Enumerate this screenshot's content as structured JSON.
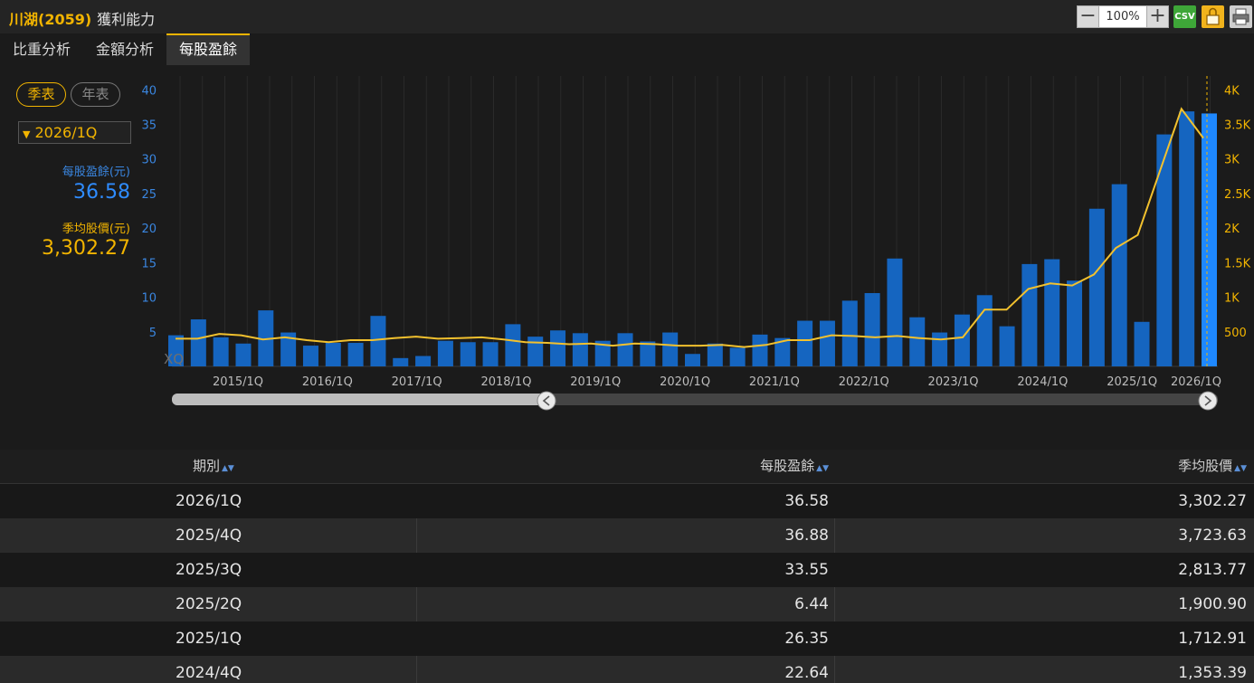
{
  "header": {
    "title": "川湖(2059)",
    "subtitle": "獲利能力",
    "zoom": "100%",
    "csv_label": "CSV",
    "icons": [
      "minus-icon",
      "plus-icon",
      "csv-icon",
      "lock-icon",
      "print-icon"
    ]
  },
  "tabs": [
    {
      "label": "比重分析"
    },
    {
      "label": "金額分析"
    },
    {
      "label": "每股盈餘",
      "active": true
    }
  ],
  "controls": {
    "quarterly": "季表",
    "annual": "年表",
    "period": "2026/1Q"
  },
  "summary": {
    "eps_label": "每股盈餘(元)",
    "eps_value": "36.58",
    "price_label": "季均股價(元)",
    "price_value": "3,302.27"
  },
  "chart_data": {
    "type": "bar",
    "watermark": "XQ",
    "colors": {
      "bars": "#1565c0",
      "selected_bar": "#1e88ff",
      "line": "#f2c12e"
    },
    "x_tick_labels": [
      "2015/1Q",
      "2016/1Q",
      "2017/1Q",
      "2018/1Q",
      "2019/1Q",
      "2020/1Q",
      "2021/1Q",
      "2022/1Q",
      "2023/1Q",
      "2024/1Q",
      "2025/1Q",
      "2026/1Q"
    ],
    "y_left": {
      "ticks": [
        "5",
        "10",
        "15",
        "20",
        "25",
        "30",
        "35",
        "40"
      ],
      "range": [
        0,
        42
      ]
    },
    "y_right": {
      "ticks": [
        "500",
        "1K",
        "1.5K",
        "2K",
        "2.5K",
        "3K",
        "3.5K",
        "4K"
      ],
      "range": [
        0,
        4200
      ]
    },
    "series": [
      {
        "axis": "left",
        "values": [
          4.5,
          6.8,
          4.2,
          3.3,
          8.1,
          4.9,
          3.0,
          3.4,
          3.4,
          7.3,
          1.2,
          1.5,
          3.7,
          3.5,
          3.5,
          6.1,
          4.3,
          5.2,
          4.8,
          3.7,
          4.8,
          3.6,
          4.9,
          1.8,
          3.3,
          2.7,
          4.6,
          4.1,
          6.6,
          6.6,
          9.5,
          10.6,
          15.6,
          7.1,
          4.9,
          7.5,
          10.3,
          5.8,
          14.8,
          15.5,
          12.4,
          22.8,
          26.35,
          6.44,
          33.55,
          36.88,
          36.58
        ]
      },
      {
        "axis": "right",
        "values": [
          400,
          400,
          470,
          450,
          390,
          420,
          380,
          350,
          380,
          380,
          410,
          430,
          400,
          410,
          420,
          390,
          350,
          340,
          320,
          330,
          300,
          330,
          320,
          300,
          300,
          310,
          280,
          310,
          380,
          380,
          450,
          440,
          420,
          440,
          410,
          390,
          420,
          820,
          820,
          1120,
          1200,
          1170,
          1330,
          1712.91,
          1900.9,
          2813.77,
          3723.63,
          3302.27
        ]
      }
    ]
  },
  "table": {
    "headers": [
      "期別",
      "每股盈餘",
      "季均股價"
    ],
    "rows": [
      [
        "2026/1Q",
        "36.58",
        "3,302.27"
      ],
      [
        "2025/4Q",
        "36.88",
        "3,723.63"
      ],
      [
        "2025/3Q",
        "33.55",
        "2,813.77"
      ],
      [
        "2025/2Q",
        "6.44",
        "1,900.90"
      ],
      [
        "2025/1Q",
        "26.35",
        "1,712.91"
      ],
      [
        "2024/4Q",
        "22.64",
        "1,353.39"
      ]
    ]
  }
}
